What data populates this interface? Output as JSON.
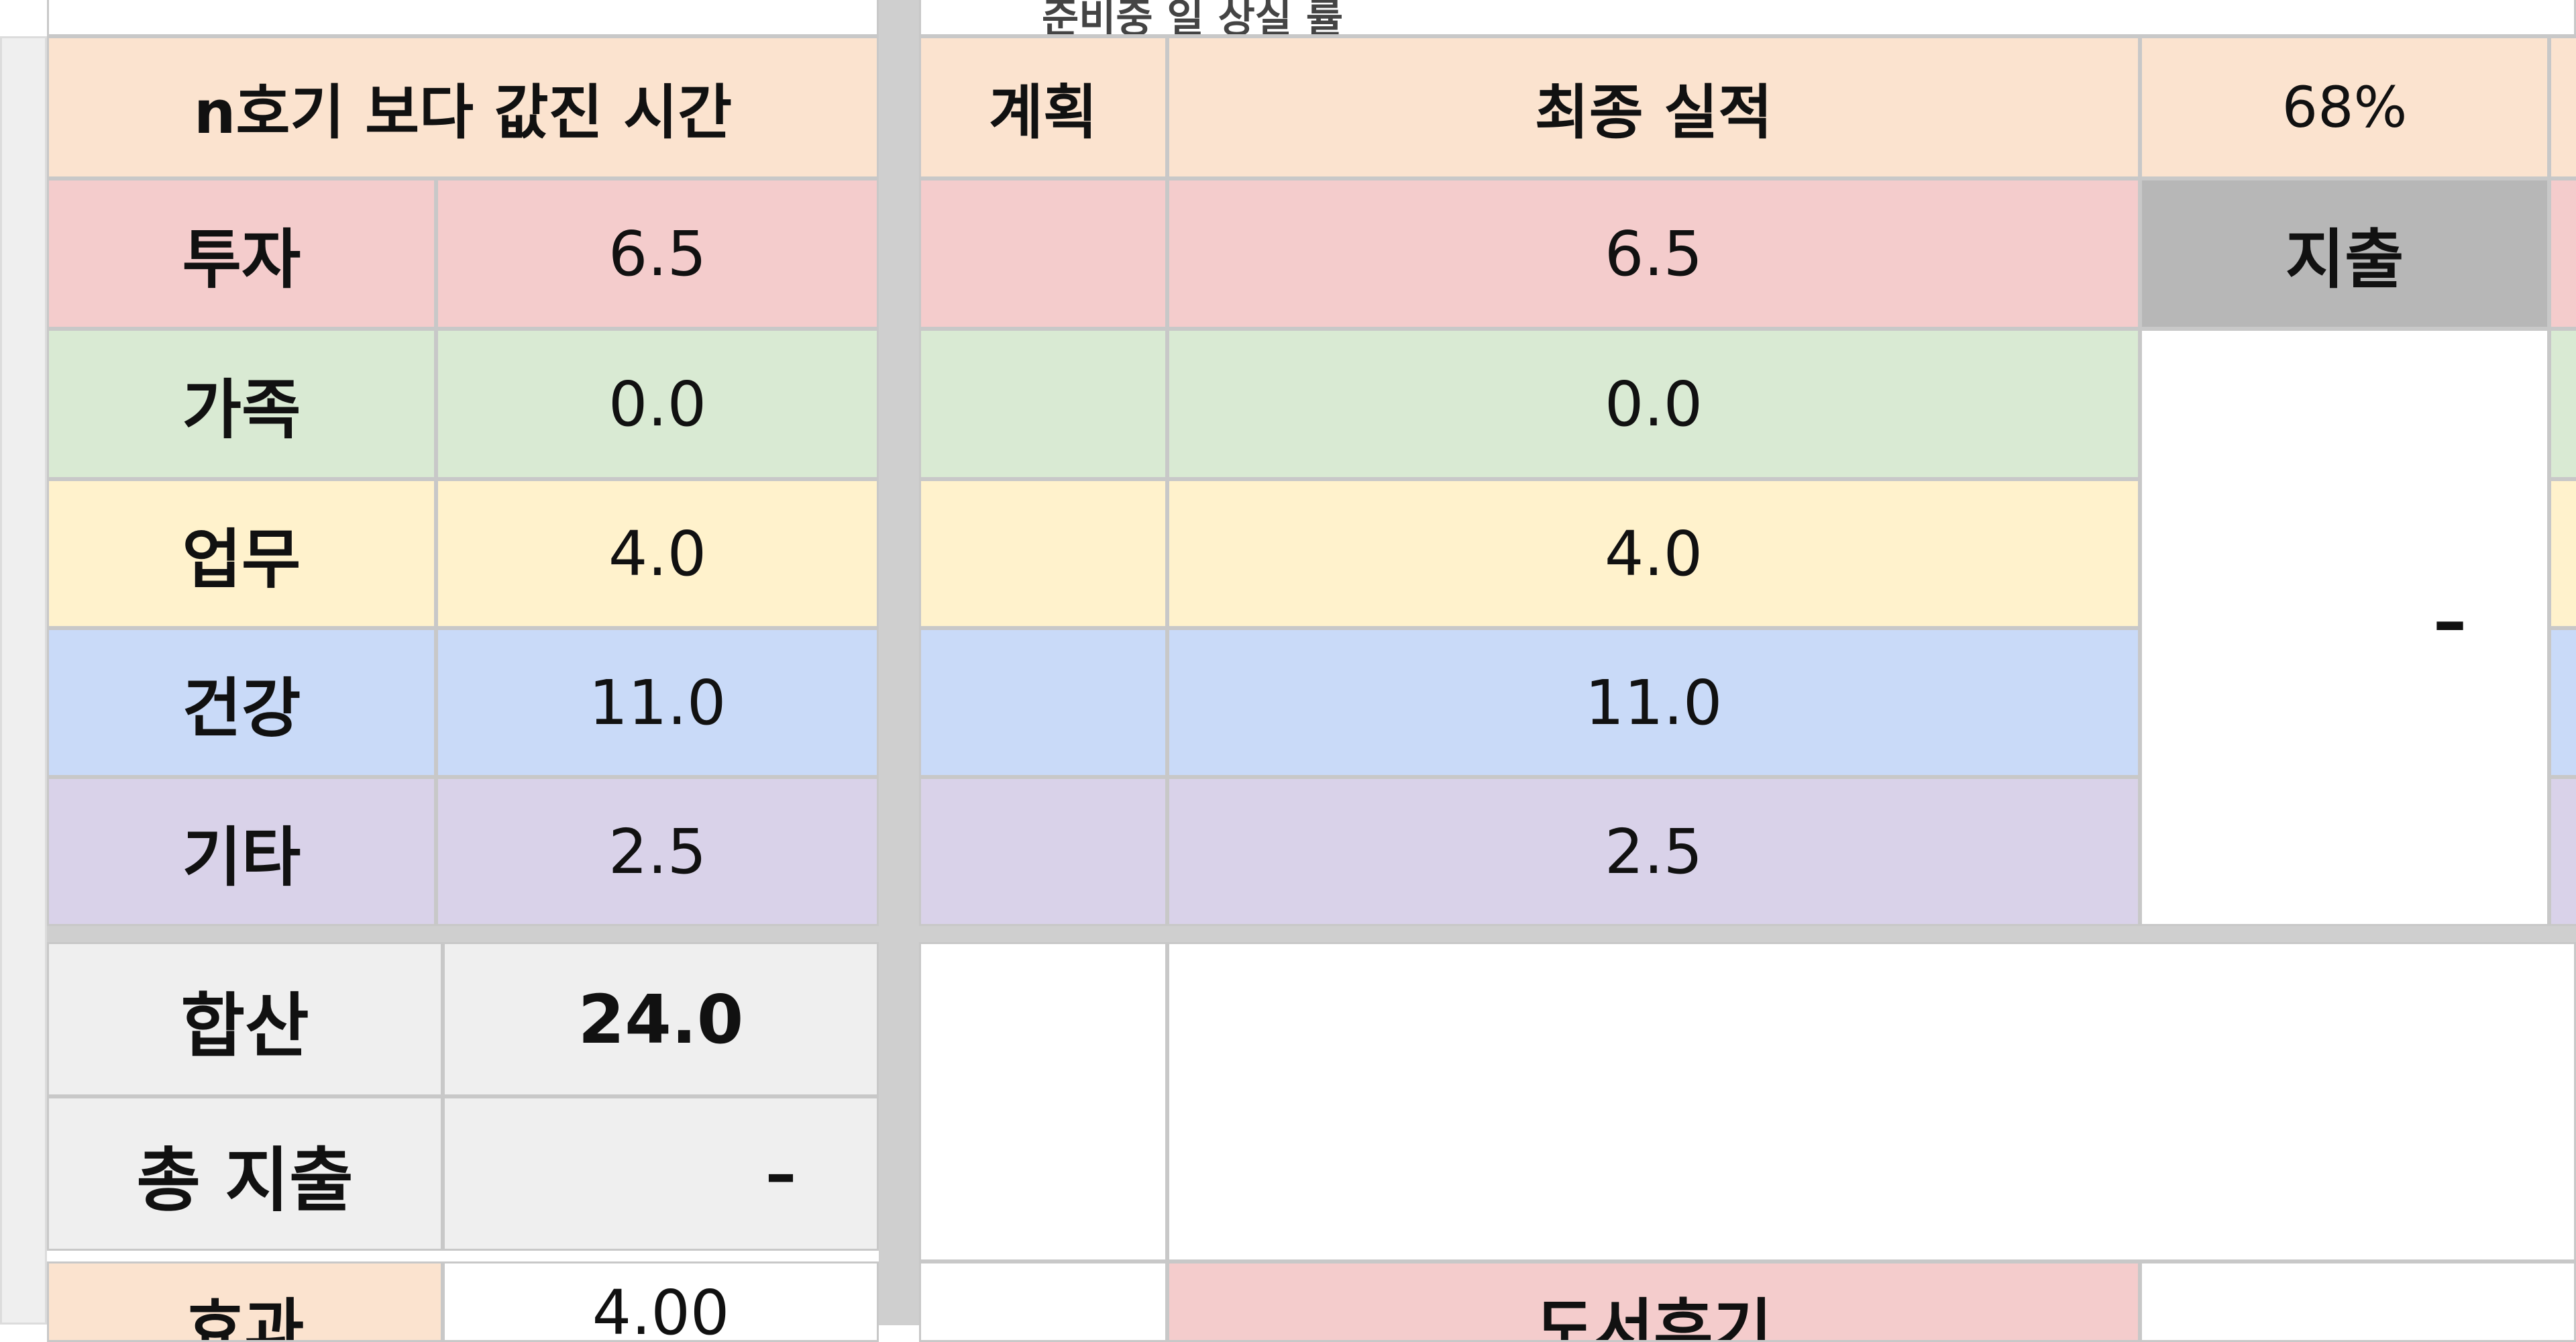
{
  "top_fragment": "준비중 일 상실 률",
  "left_table": {
    "header": "n호기 보다 값진 시간",
    "rows": [
      {
        "label": "투자",
        "value": "6.5"
      },
      {
        "label": "가족",
        "value": "0.0"
      },
      {
        "label": "업무",
        "value": "4.0"
      },
      {
        "label": "건강",
        "value": "11.0"
      },
      {
        "label": "기타",
        "value": "2.5"
      }
    ],
    "total_label": "합산",
    "total_value": "24.0",
    "expense_label": "총 지출",
    "expense_value": "–",
    "next_label": "효과",
    "next_value": "4.00"
  },
  "right_table": {
    "plan_header": "계획",
    "result_header": "최종 실적",
    "percent": "68%",
    "results": [
      "6.5",
      "0.0",
      "4.0",
      "11.0",
      "2.5"
    ],
    "expense_header": "지출",
    "expense_value": "–",
    "bottom_label": "도서후기"
  },
  "colors": {
    "header": "#fbe3cf",
    "investment": "#f4cccc",
    "family": "#d9ead3",
    "work": "#fff2cc",
    "health": "#c9daf8",
    "other": "#d9d2e9",
    "total": "#efefef",
    "expense_header": "#b7b7b7"
  }
}
